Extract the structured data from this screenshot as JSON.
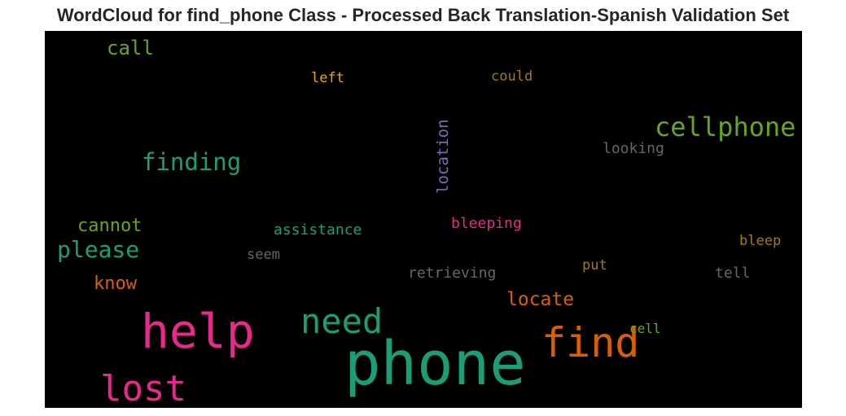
{
  "title": "WordCloud for find_phone Class - Processed Back Translation-Spanish Validation Set",
  "words": {
    "phone": {
      "text": "phone",
      "color": "#1b9e77"
    },
    "help": {
      "text": "help",
      "color": "#e7298a"
    },
    "find": {
      "text": "find",
      "color": "#d95f02"
    },
    "lost": {
      "text": "lost",
      "color": "#e7298a"
    },
    "need": {
      "text": "need",
      "color": "#1b9e77"
    },
    "cellphone": {
      "text": "cellphone",
      "color": "#66a61e"
    },
    "finding": {
      "text": "finding",
      "color": "#1b9e77"
    },
    "please": {
      "text": "please",
      "color": "#1b9e77"
    },
    "locate": {
      "text": "locate",
      "color": "#d95f02"
    },
    "call": {
      "text": "call",
      "color": "#66a61e"
    },
    "cannot": {
      "text": "cannot",
      "color": "#66a61e"
    },
    "know": {
      "text": "know",
      "color": "#d95f02"
    },
    "location": {
      "text": "location",
      "color": "#7570b3"
    },
    "bleeping": {
      "text": "bleeping",
      "color": "#e7298a"
    },
    "assistance": {
      "text": "assistance",
      "color": "#1b9e77"
    },
    "retrieving": {
      "text": "retrieving",
      "color": "#666666"
    },
    "looking": {
      "text": "looking",
      "color": "#666666"
    },
    "left": {
      "text": "left",
      "color": "#e6ab02"
    },
    "could": {
      "text": "could",
      "color": "#a6761d"
    },
    "bleep": {
      "text": "bleep",
      "color": "#a6761d"
    },
    "put": {
      "text": "put",
      "color": "#a6761d"
    },
    "seem": {
      "text": "seem",
      "color": "#666666"
    },
    "tell": {
      "text": "tell",
      "color": "#666666"
    },
    "cell": {
      "text": "cell",
      "color": "#66a61e"
    }
  }
}
